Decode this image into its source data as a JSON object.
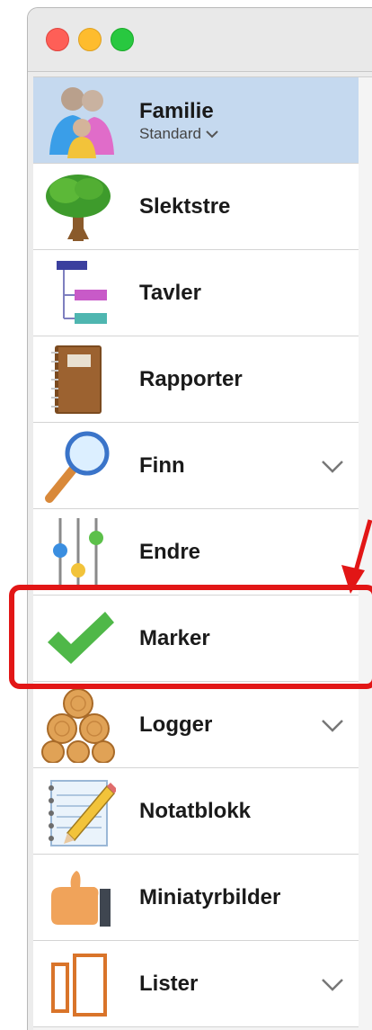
{
  "window": {
    "traffic_lights": [
      "close",
      "minimize",
      "zoom"
    ]
  },
  "sidebar": {
    "items": [
      {
        "label": "Familie",
        "sublabel": "Standard",
        "icon": "family-icon",
        "selected": true
      },
      {
        "label": "Slektstre",
        "icon": "tree-icon"
      },
      {
        "label": "Tavler",
        "icon": "charts-icon"
      },
      {
        "label": "Rapporter",
        "icon": "reports-book-icon"
      },
      {
        "label": "Finn",
        "icon": "magnifier-icon",
        "expandable": true
      },
      {
        "label": "Endre",
        "icon": "sliders-icon"
      },
      {
        "label": "Marker",
        "icon": "checkmark-icon"
      },
      {
        "label": "Logger",
        "icon": "logs-icon",
        "expandable": true
      },
      {
        "label": "Notatblokk",
        "icon": "notepad-icon"
      },
      {
        "label": "Miniatyrbilder",
        "icon": "thumbs-up-icon"
      },
      {
        "label": "Lister",
        "icon": "lists-icon",
        "expandable": true
      }
    ]
  },
  "annotation": {
    "color": "#e21616",
    "target": "Marker"
  },
  "colors": {
    "selection": "#c5d9ef",
    "annotation": "#e21616"
  }
}
